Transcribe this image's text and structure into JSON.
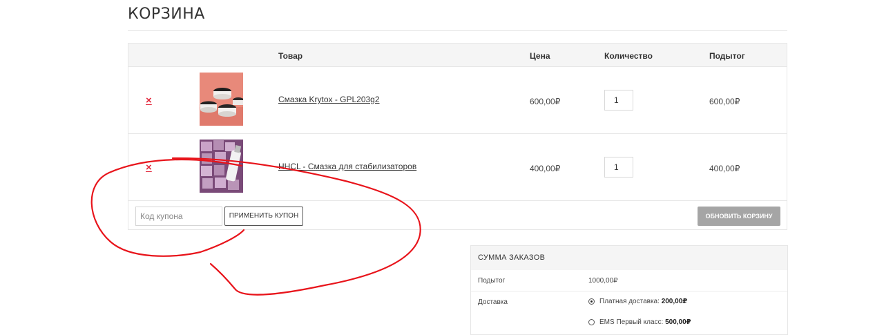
{
  "page": {
    "title": "КОРЗИНА"
  },
  "cart": {
    "headers": {
      "product": "Товар",
      "price": "Цена",
      "quantity": "Количество",
      "subtotal": "Подытог"
    },
    "items": [
      {
        "remove": "×",
        "name": "Смазка Krytox - GPL203g2",
        "price": "600,00₽",
        "quantity": "1",
        "subtotal": "600,00₽"
      },
      {
        "remove": "×",
        "name": "HHCL - Смазка для стабилизаторов",
        "price": "400,00₽",
        "quantity": "1",
        "subtotal": "400,00₽"
      }
    ],
    "coupon": {
      "placeholder": "Код купона",
      "apply_label": "ПРИМЕНИТЬ КУПОН"
    },
    "update_label": "ОБНОВИТЬ КОРЗИНУ"
  },
  "totals": {
    "title": "СУММА ЗАКАЗОВ",
    "subtotal_label": "Подытог",
    "subtotal_value": "1000,00₽",
    "shipping_label": "Доставка",
    "shipping_options": [
      {
        "label": "Платная доставка:",
        "price": "200,00₽",
        "selected": true
      },
      {
        "label": "EMS Первый класс:",
        "price": "500,00₽",
        "selected": false
      }
    ]
  },
  "colors": {
    "remove": "#e2283c",
    "annotation": "#e8141b",
    "update_button": "#a5a5a5"
  }
}
